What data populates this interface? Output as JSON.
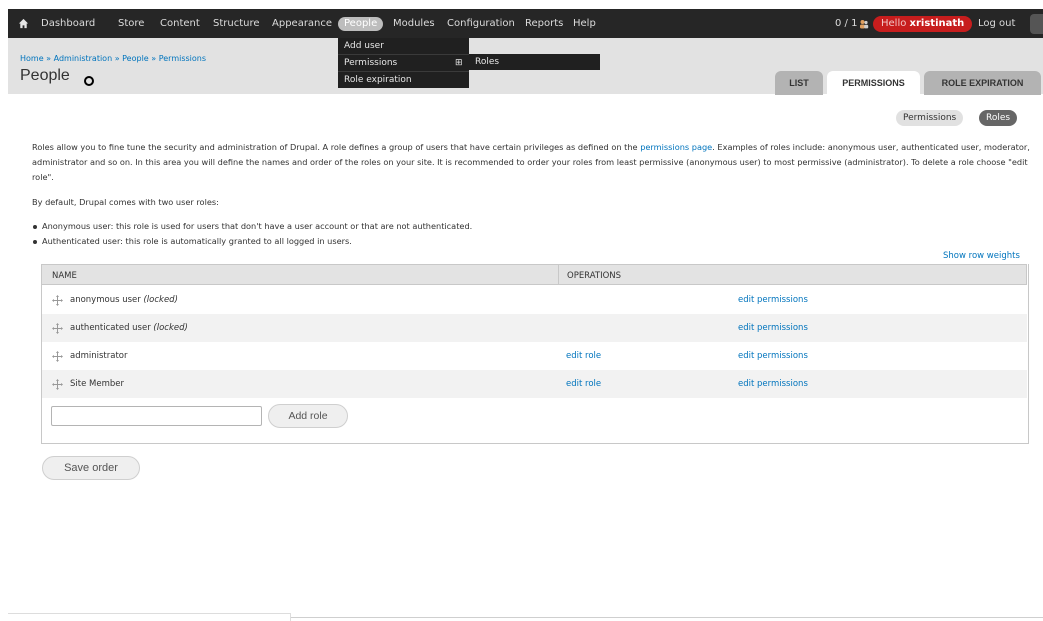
{
  "toolbar": {
    "items": [
      "Dashboard",
      "Store",
      "Content",
      "Structure",
      "Appearance",
      "People",
      "Modules",
      "Configuration",
      "Reports",
      "Help"
    ],
    "counter": "0 / 1",
    "hello": "Hello",
    "username": "xristinath",
    "logout": "Log out"
  },
  "dropdown": {
    "items": [
      "Add user",
      "Permissions",
      "Role expiration"
    ],
    "submenu": "Roles",
    "plus": "⊞"
  },
  "breadcrumb": [
    "Home",
    "Administration",
    "People",
    "Permissions"
  ],
  "breadcrumb_sep": " » ",
  "page_title": "People",
  "tabs": [
    "LIST",
    "PERMISSIONS",
    "ROLE EXPIRATION"
  ],
  "secondary_tabs": [
    "Permissions",
    "Roles"
  ],
  "intro": {
    "before_link": "Roles allow you to fine tune the security and administration of Drupal. A role defines a group of users that have certain privileges as defined on the ",
    "link": "permissions page",
    "after_link": ". Examples of roles include: anonymous user, authenticated user, moderator, administrator and so on. In this area you will define the names and order of the roles on your site. It is recommended to order your roles from least permissive (anonymous user) to most permissive (administrator). To delete a role choose \"edit role\"."
  },
  "default_line": "By default, Drupal comes with two user roles:",
  "bullets": [
    "Anonymous user: this role is used for users that don't have a user account or that are not authenticated.",
    "Authenticated user: this role is automatically granted to all logged in users."
  ],
  "show_row_weights": "Show row weights",
  "table": {
    "headers": [
      "NAME",
      "OPERATIONS"
    ],
    "rows": [
      {
        "name": "anonymous user",
        "locked": "(locked)",
        "edit_role": "",
        "edit_permissions": "edit permissions"
      },
      {
        "name": "authenticated user",
        "locked": "(locked)",
        "edit_role": "",
        "edit_permissions": "edit permissions"
      },
      {
        "name": "administrator",
        "locked": "",
        "edit_role": "edit role",
        "edit_permissions": "edit permissions"
      },
      {
        "name": "Site Member",
        "locked": "",
        "edit_role": "edit role",
        "edit_permissions": "edit permissions"
      }
    ]
  },
  "add_role": {
    "value": "",
    "button": "Add role"
  },
  "save_order": "Save order",
  "colors": {
    "toolbar": "#262626",
    "link": "#0074bd",
    "hello_pill": "#c71d1d",
    "header": "#e2e2e2"
  }
}
